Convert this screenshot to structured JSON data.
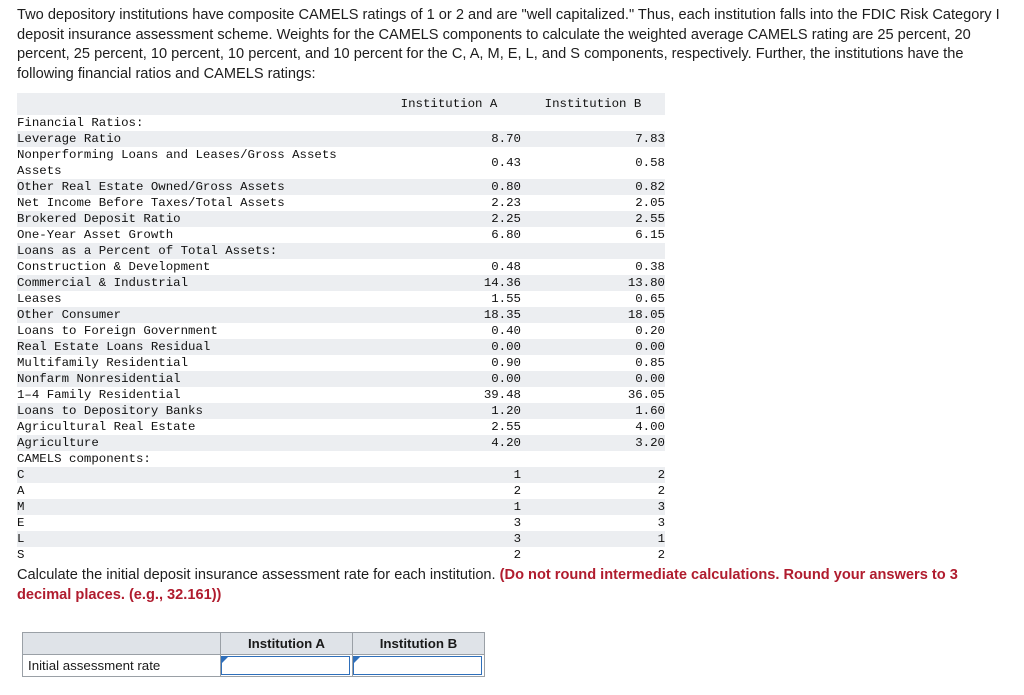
{
  "intro": {
    "paragraph": "Two depository institutions have composite CAMELS ratings of 1 or 2 and are \"well capitalized.\" Thus, each institution falls into the FDIC Risk Category I deposit insurance assessment scheme. Weights for the CAMELS components to calculate the weighted average CAMELS rating are 25 percent, 20 percent, 25 percent, 10 percent, 10 percent, and 10 percent for the C, A, M, E, L, and S components, respectively. Further, the institutions have the following financial ratios and CAMELS ratings:"
  },
  "data_table": {
    "headers": [
      "",
      "Institution A",
      "Institution B"
    ],
    "rows": [
      {
        "label": "Financial Ratios:",
        "indent": 0,
        "a": "",
        "b": "",
        "band": false,
        "type": "section"
      },
      {
        "label": "Leverage Ratio",
        "indent": 1,
        "a": "8.70",
        "b": "7.83",
        "band": true,
        "type": "data"
      },
      {
        "label": "Nonperforming Loans and Leases/Gross Assets",
        "indent": 1,
        "a": "0.43",
        "b": "0.58",
        "band": false,
        "type": "data2"
      },
      {
        "label": "Other Real Estate Owned/Gross Assets",
        "indent": 1,
        "a": "0.80",
        "b": "0.82",
        "band": true,
        "type": "data"
      },
      {
        "label": "Net Income Before Taxes/Total Assets",
        "indent": 1,
        "a": "2.23",
        "b": "2.05",
        "band": false,
        "type": "data"
      },
      {
        "label": "Brokered Deposit Ratio",
        "indent": 1,
        "a": "2.25",
        "b": "2.55",
        "band": true,
        "type": "data"
      },
      {
        "label": "One-Year Asset Growth",
        "indent": 1,
        "a": "6.80",
        "b": "6.15",
        "band": false,
        "type": "data"
      },
      {
        "label": "Loans as a Percent of Total Assets:",
        "indent": 0,
        "a": "",
        "b": "",
        "band": true,
        "type": "section"
      },
      {
        "label": "Construction & Development",
        "indent": 1,
        "a": "0.48",
        "b": "0.38",
        "band": false,
        "type": "data"
      },
      {
        "label": "Commercial & Industrial",
        "indent": 1,
        "a": "14.36",
        "b": "13.80",
        "band": true,
        "type": "data"
      },
      {
        "label": "Leases",
        "indent": 1,
        "a": "1.55",
        "b": "0.65",
        "band": false,
        "type": "data"
      },
      {
        "label": "Other Consumer",
        "indent": 1,
        "a": "18.35",
        "b": "18.05",
        "band": true,
        "type": "data"
      },
      {
        "label": "Loans to Foreign Government",
        "indent": 1,
        "a": "0.40",
        "b": "0.20",
        "band": false,
        "type": "data"
      },
      {
        "label": "Real Estate Loans Residual",
        "indent": 1,
        "a": "0.00",
        "b": "0.00",
        "band": true,
        "type": "data"
      },
      {
        "label": "Multifamily Residential",
        "indent": 1,
        "a": "0.90",
        "b": "0.85",
        "band": false,
        "type": "data"
      },
      {
        "label": "Nonfarm Nonresidential",
        "indent": 1,
        "a": "0.00",
        "b": "0.00",
        "band": true,
        "type": "data"
      },
      {
        "label": "1–4 Family Residential",
        "indent": 1,
        "a": "39.48",
        "b": "36.05",
        "band": false,
        "type": "data"
      },
      {
        "label": "Loans to Depository Banks",
        "indent": 1,
        "a": "1.20",
        "b": "1.60",
        "band": true,
        "type": "data"
      },
      {
        "label": "Agricultural Real Estate",
        "indent": 1,
        "a": "2.55",
        "b": "4.00",
        "band": false,
        "type": "data"
      },
      {
        "label": "Agriculture",
        "indent": 1,
        "a": "4.20",
        "b": "3.20",
        "band": true,
        "type": "data"
      },
      {
        "label": "CAMELS components:",
        "indent": 0,
        "a": "",
        "b": "",
        "band": false,
        "type": "section"
      },
      {
        "label": "C",
        "indent": 2,
        "a": "1",
        "b": "2",
        "band": true,
        "type": "camels"
      },
      {
        "label": "A",
        "indent": 2,
        "a": "2",
        "b": "2",
        "band": false,
        "type": "camels"
      },
      {
        "label": "M",
        "indent": 2,
        "a": "1",
        "b": "3",
        "band": true,
        "type": "camels"
      },
      {
        "label": "E",
        "indent": 2,
        "a": "3",
        "b": "3",
        "band": false,
        "type": "camels"
      },
      {
        "label": "L",
        "indent": 2,
        "a": "3",
        "b": "1",
        "band": true,
        "type": "camels"
      },
      {
        "label": "S",
        "indent": 2,
        "a": "2",
        "b": "2",
        "band": false,
        "type": "camels"
      }
    ],
    "wrapped_row_second_line": "Assets"
  },
  "question": {
    "lead": "Calculate the initial deposit insurance assessment rate for each institution. ",
    "emphasis": "(Do not round intermediate calculations. Round your answers to 3 decimal places. (e.g., 32.161))"
  },
  "answer_table": {
    "corner": "",
    "headers": [
      "Institution A",
      "Institution B"
    ],
    "row_label": "Initial assessment rate",
    "values": [
      "",
      ""
    ]
  },
  "colors": {
    "band": "#eceef1",
    "header_band": "#dfe3e8",
    "emphasis": "#b01c2e",
    "input_border": "#2f6fba"
  }
}
